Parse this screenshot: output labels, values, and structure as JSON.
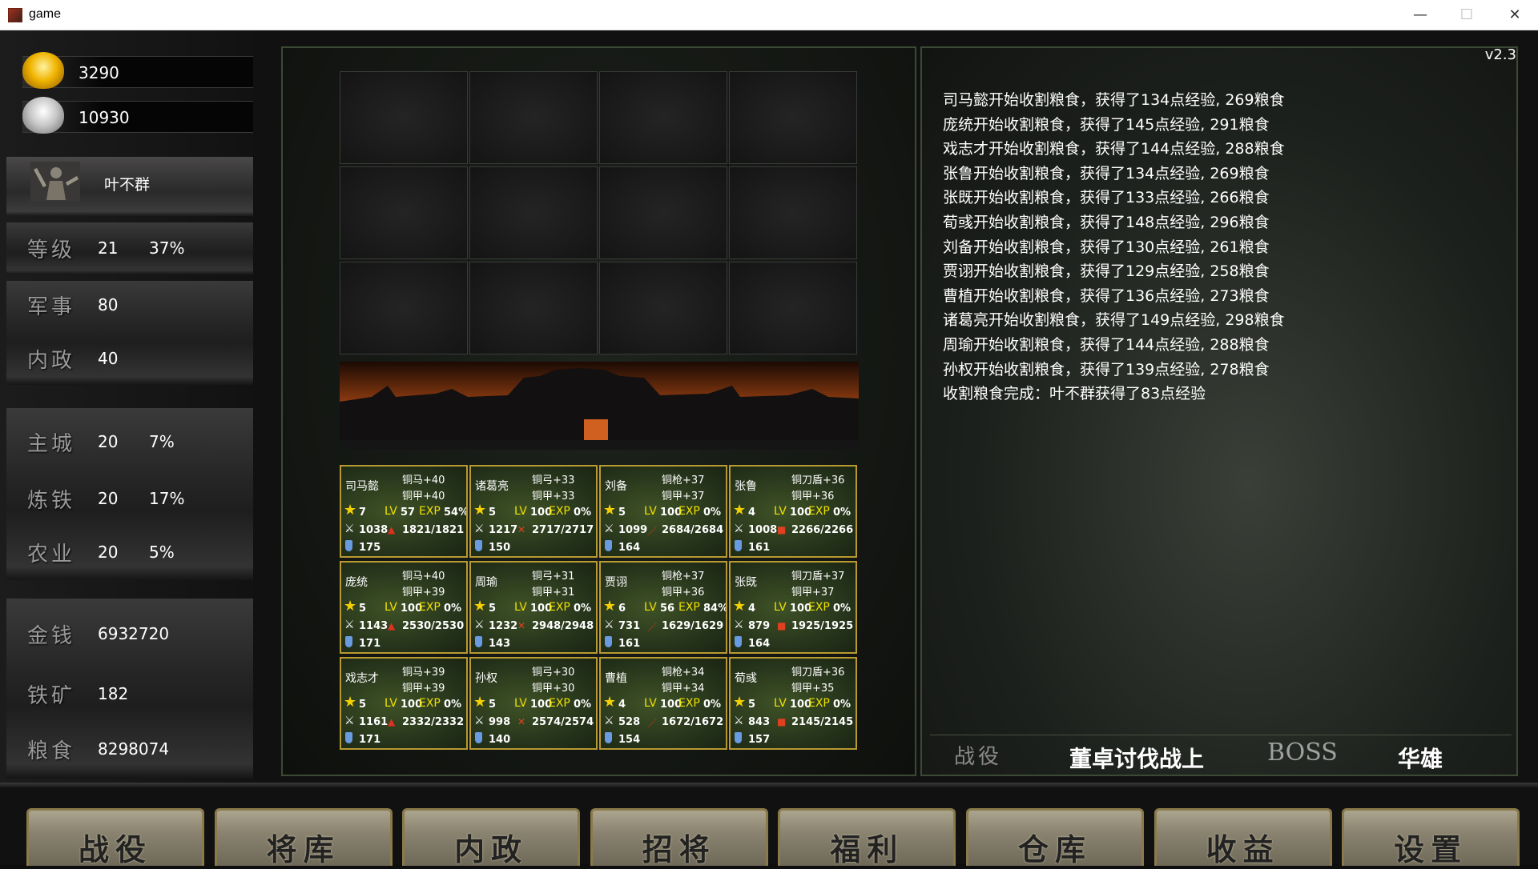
{
  "window": {
    "title": "game"
  },
  "resources": {
    "gold": "3290",
    "silver": "10930"
  },
  "player": {
    "name": "叶不群"
  },
  "stats": [
    {
      "label": "等级",
      "value": "21",
      "extra": "37%"
    },
    {
      "label": "军事",
      "value": "80",
      "extra": ""
    },
    {
      "label": "内政",
      "value": "40",
      "extra": ""
    },
    {
      "label": "主城",
      "value": "20",
      "extra": "7%"
    },
    {
      "label": "炼铁",
      "value": "20",
      "extra": "17%"
    },
    {
      "label": "农业",
      "value": "20",
      "extra": "5%"
    },
    {
      "label": "金钱",
      "value": "6932720",
      "extra": ""
    },
    {
      "label": "铁矿",
      "value": "182",
      "extra": ""
    },
    {
      "label": "粮食",
      "value": "8298074",
      "extra": ""
    }
  ],
  "card_labels": {
    "lv": "LV",
    "exp": "EXP"
  },
  "generals": [
    {
      "name": "司马懿",
      "b1": "铜马+40",
      "b2": "铜甲+40",
      "stars": "7",
      "level": "57",
      "exp": "54%",
      "atk": "1038",
      "hp": "1821/1821",
      "def": "175",
      "hp_icon": "▲",
      "hp_color": "#e03020"
    },
    {
      "name": "诸葛亮",
      "b1": "铜弓+33",
      "b2": "铜甲+33",
      "stars": "5",
      "level": "100",
      "exp": "0%",
      "atk": "1217",
      "hp": "2717/2717",
      "def": "150",
      "hp_icon": "✕",
      "hp_color": "#e04020"
    },
    {
      "name": "刘备",
      "b1": "铜枪+37",
      "b2": "铜甲+37",
      "stars": "5",
      "level": "100",
      "exp": "0%",
      "atk": "1099",
      "hp": "2684/2684",
      "def": "164",
      "hp_icon": "／",
      "hp_color": "#e03020"
    },
    {
      "name": "张鲁",
      "b1": "铜刀盾+36",
      "b2": "铜甲+36",
      "stars": "4",
      "level": "100",
      "exp": "0%",
      "atk": "1008",
      "hp": "2266/2266",
      "def": "161",
      "hp_icon": "■",
      "hp_color": "#e04020"
    },
    {
      "name": "庞统",
      "b1": "铜马+40",
      "b2": "铜甲+39",
      "stars": "5",
      "level": "100",
      "exp": "0%",
      "atk": "1143",
      "hp": "2530/2530",
      "def": "171",
      "hp_icon": "▲",
      "hp_color": "#e03020"
    },
    {
      "name": "周瑜",
      "b1": "铜弓+31",
      "b2": "铜甲+31",
      "stars": "5",
      "level": "100",
      "exp": "0%",
      "atk": "1232",
      "hp": "2948/2948",
      "def": "143",
      "hp_icon": "✕",
      "hp_color": "#e04020"
    },
    {
      "name": "贾诩",
      "b1": "铜枪+37",
      "b2": "铜甲+36",
      "stars": "6",
      "level": "56",
      "exp": "84%",
      "atk": "731",
      "hp": "1629/1629",
      "def": "161",
      "hp_icon": "／",
      "hp_color": "#e03020"
    },
    {
      "name": "张既",
      "b1": "铜刀盾+37",
      "b2": "铜甲+37",
      "stars": "4",
      "level": "100",
      "exp": "0%",
      "atk": "879",
      "hp": "1925/1925",
      "def": "164",
      "hp_icon": "■",
      "hp_color": "#e04020"
    },
    {
      "name": "戏志才",
      "b1": "铜马+39",
      "b2": "铜甲+39",
      "stars": "5",
      "level": "100",
      "exp": "0%",
      "atk": "1161",
      "hp": "2332/2332",
      "def": "171",
      "hp_icon": "▲",
      "hp_color": "#e03020"
    },
    {
      "name": "孙权",
      "b1": "铜弓+30",
      "b2": "铜甲+30",
      "stars": "5",
      "level": "100",
      "exp": "0%",
      "atk": "998",
      "hp": "2574/2574",
      "def": "140",
      "hp_icon": "✕",
      "hp_color": "#e04020"
    },
    {
      "name": "曹植",
      "b1": "铜枪+34",
      "b2": "铜甲+34",
      "stars": "4",
      "level": "100",
      "exp": "0%",
      "atk": "528",
      "hp": "1672/1672",
      "def": "154",
      "hp_icon": "／",
      "hp_color": "#e03020"
    },
    {
      "name": "荀彧",
      "b1": "铜刀盾+36",
      "b2": "铜甲+35",
      "stars": "5",
      "level": "100",
      "exp": "0%",
      "atk": "843",
      "hp": "2145/2145",
      "def": "157",
      "hp_icon": "■",
      "hp_color": "#e04020"
    }
  ],
  "version": "v2.3",
  "log": [
    "司马懿开始收割粮食，获得了134点经验, 269粮食",
    "庞统开始收割粮食，获得了145点经验, 291粮食",
    "戏志才开始收割粮食，获得了144点经验, 288粮食",
    "张鲁开始收割粮食，获得了134点经验, 269粮食",
    "张既开始收割粮食，获得了133点经验, 266粮食",
    "荀彧开始收割粮食，获得了148点经验, 296粮食",
    "刘备开始收割粮食，获得了130点经验, 261粮食",
    "贾诩开始收割粮食，获得了129点经验, 258粮食",
    "曹植开始收割粮食，获得了136点经验, 273粮食",
    "诸葛亮开始收割粮食，获得了149点经验, 298粮食",
    "周瑜开始收割粮食，获得了144点经验, 288粮食",
    "孙权开始收割粮食，获得了139点经验, 278粮食",
    "收割粮食完成：叶不群获得了83点经验"
  ],
  "battle_tabs": {
    "campaign": "战役",
    "stage": "董卓讨伐战上",
    "boss_label": "BOSS",
    "boss_name": "华雄"
  },
  "nav": [
    "战役",
    "将库",
    "内政",
    "招将",
    "福利",
    "仓库",
    "收益",
    "设置"
  ],
  "colors": {
    "card_border": "#b89a30",
    "card_bg": "#33451f",
    "star": "#f5d000",
    "exp_text": "#f0e000"
  }
}
